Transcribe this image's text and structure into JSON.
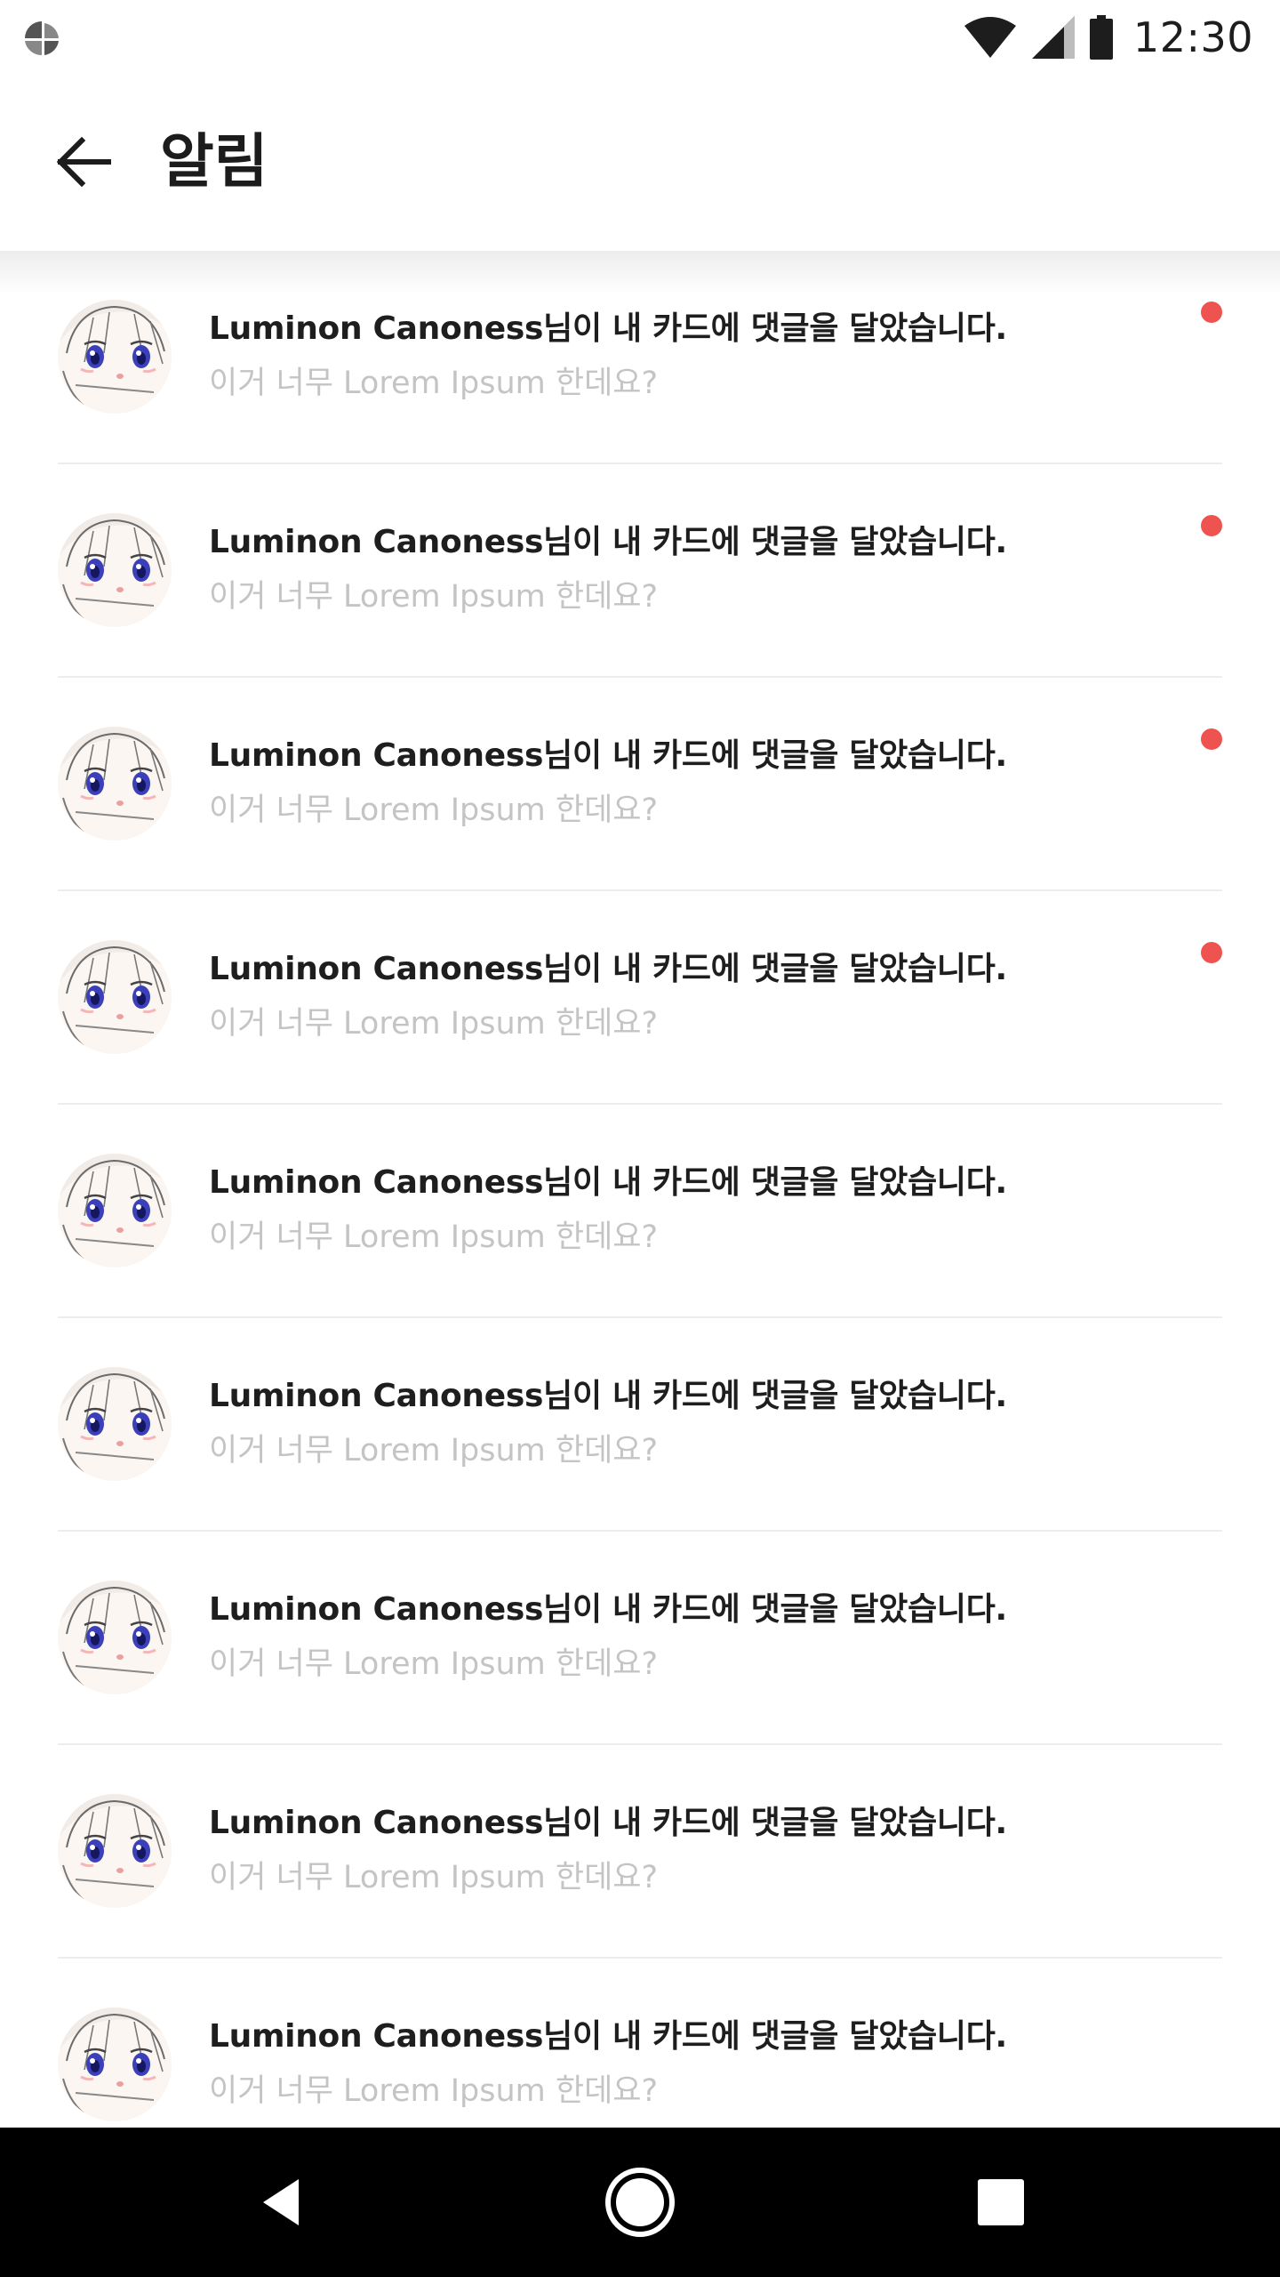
{
  "status_bar": {
    "time": "12:30",
    "icons": [
      "app-notification-icon",
      "wifi-icon",
      "cell-signal-icon",
      "battery-icon"
    ]
  },
  "app_bar": {
    "back_icon": "arrow-left-icon",
    "title": "알림"
  },
  "colors": {
    "unread_dot": "#ef5350",
    "title_text": "#1e1e1e",
    "body_text": "#c4c4c4",
    "divider": "#ededed",
    "nav_bar": "#000000"
  },
  "notifications": [
    {
      "title": "Luminon Canoness님이 내 카드에 댓글을 달았습니다.",
      "body": "이거 너무 Lorem Ipsum 한데요?",
      "unread": true
    },
    {
      "title": "Luminon Canoness님이 내 카드에 댓글을 달았습니다.",
      "body": "이거 너무 Lorem Ipsum 한데요?",
      "unread": true
    },
    {
      "title": "Luminon Canoness님이 내 카드에 댓글을 달았습니다.",
      "body": "이거 너무 Lorem Ipsum 한데요?",
      "unread": true
    },
    {
      "title": "Luminon Canoness님이 내 카드에 댓글을 달았습니다.",
      "body": "이거 너무 Lorem Ipsum 한데요?",
      "unread": true
    },
    {
      "title": "Luminon Canoness님이 내 카드에 댓글을 달았습니다.",
      "body": "이거 너무 Lorem Ipsum 한데요?",
      "unread": false
    },
    {
      "title": "Luminon Canoness님이 내 카드에 댓글을 달았습니다.",
      "body": "이거 너무 Lorem Ipsum 한데요?",
      "unread": false
    },
    {
      "title": "Luminon Canoness님이 내 카드에 댓글을 달았습니다.",
      "body": "이거 너무 Lorem Ipsum 한데요?",
      "unread": false
    },
    {
      "title": "Luminon Canoness님이 내 카드에 댓글을 달았습니다.",
      "body": "이거 너무 Lorem Ipsum 한데요?",
      "unread": false
    },
    {
      "title": "Luminon Canoness님이 내 카드에 댓글을 달았습니다.",
      "body": "이거 너무 Lorem Ipsum 한데요?",
      "unread": false
    }
  ],
  "nav_bar": {
    "icons": [
      "nav-back-icon",
      "nav-home-icon",
      "nav-recents-icon"
    ]
  }
}
